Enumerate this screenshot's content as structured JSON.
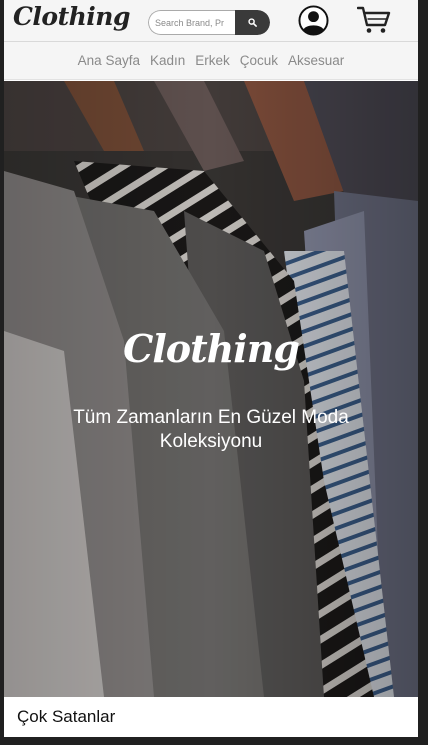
{
  "header": {
    "logo_text": "Clothing",
    "search": {
      "placeholder": "Search Brand, Pr",
      "value": ""
    },
    "icons": {
      "search": "search-icon",
      "user": "user-icon",
      "cart": "cart-icon"
    }
  },
  "nav": {
    "items": [
      "Ana Sayfa",
      "Kadın",
      "Erkek",
      "Çocuk",
      "Aksesuar"
    ]
  },
  "hero": {
    "logo_text": "Clothing",
    "tagline": "Tüm Zamanların En Güzel Moda Koleksiyonu"
  },
  "sections": {
    "best_sellers_title": "Çok Satanlar"
  },
  "colors": {
    "header_bg": "#f5f5f5",
    "nav_text": "#8a8a8a",
    "search_button": "#3a3a3a",
    "page_bg": "#202020"
  }
}
